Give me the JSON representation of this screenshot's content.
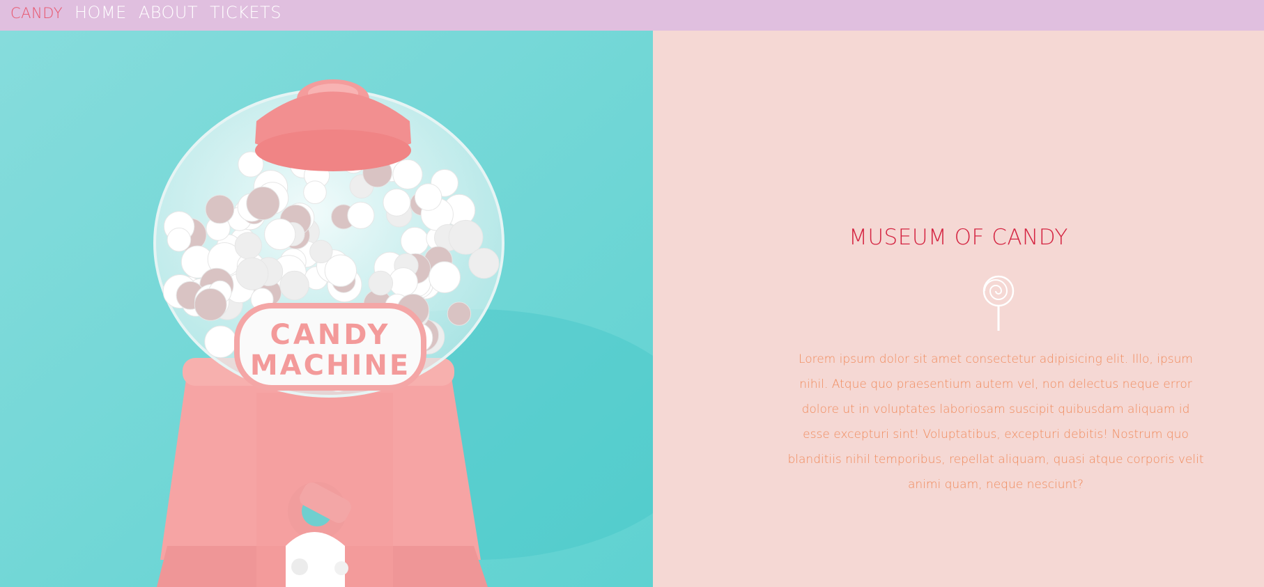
{
  "nav": {
    "brand": "CANDY",
    "links": [
      "HOME",
      "ABOUT",
      "TICKETS"
    ]
  },
  "hero": {
    "label_line1": "CANDY",
    "label_line2": "MACHINE"
  },
  "content": {
    "title": "MUSEUM OF CANDY",
    "body": "Lorem ipsum dolor sit amet consectetur adipisicing elit. Illo, ipsum nihil. Atque quo praesentium autem vel, non delectus neque error dolore ut in voluptates laboriosam suscipit quibusdam aliquam id esse excepturi sint! Voluptatibus, excepturi debitis! Nostrum quo blanditiis nihil temporibus, repellat aliquam, quasi atque corporis velit animi quam, neque nesciunt?",
    "icon": "lollipop-icon"
  },
  "colors": {
    "nav_bg": "#e0bfdf",
    "brand": "#e8536a",
    "title": "#d42340",
    "body_text": "#f08a5b",
    "content_bg": "#f5d8d4",
    "hero_bg": "#7fdcdb"
  }
}
